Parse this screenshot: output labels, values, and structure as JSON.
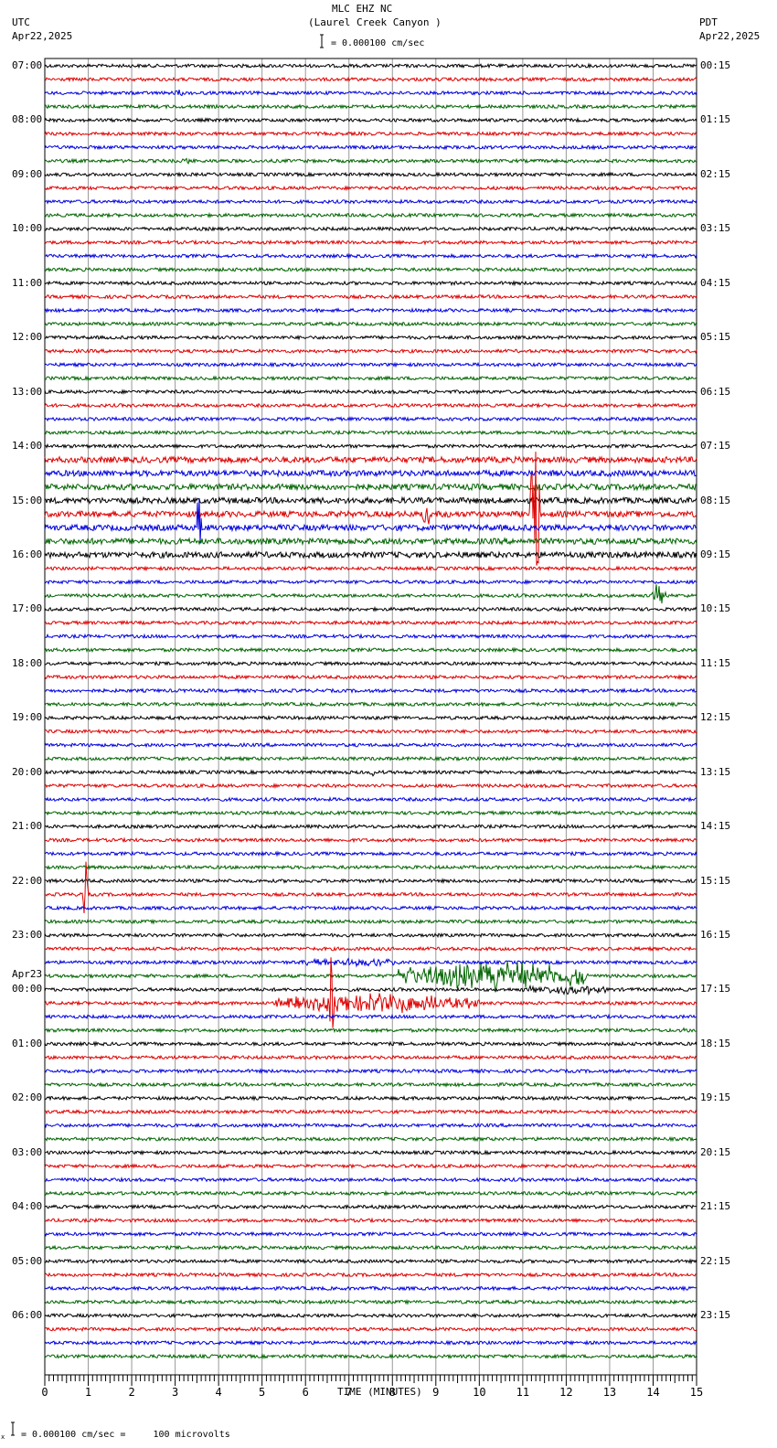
{
  "header": {
    "title": "MLC EHZ NC",
    "subtitle": "(Laurel Creek Canyon )",
    "scale": "= 0.000100 cm/sec",
    "left_tz": "UTC",
    "left_date": "Apr22,2025",
    "right_tz": "PDT",
    "right_date": "Apr22,2025"
  },
  "footer": {
    "scale_note": "= 0.000100 cm/sec =     100 microvolts",
    "footer_mark": "x"
  },
  "chart_data": {
    "type": "line",
    "title": "MLC EHZ NC (Laurel Creek Canyon )",
    "xlabel": "TIME (MINUTES)",
    "xlim": [
      0,
      15
    ],
    "xticks": [
      "0",
      "1",
      "2",
      "3",
      "4",
      "5",
      "6",
      "7",
      "8",
      "9",
      "10",
      "11",
      "12",
      "13",
      "14",
      "15"
    ],
    "trace_count": 96,
    "trace_colors": [
      "#000000",
      "#dd0000",
      "#0000dd",
      "#006400"
    ],
    "left_labels": [
      "07:00",
      "08:00",
      "09:00",
      "10:00",
      "11:00",
      "12:00",
      "13:00",
      "14:00",
      "15:00",
      "16:00",
      "17:00",
      "18:00",
      "19:00",
      "20:00",
      "21:00",
      "22:00",
      "23:00",
      "00:00",
      "01:00",
      "02:00",
      "03:00",
      "04:00",
      "05:00",
      "06:00"
    ],
    "left_date_change": "Apr23",
    "right_labels": [
      "00:15",
      "01:15",
      "02:15",
      "03:15",
      "04:15",
      "05:15",
      "06:15",
      "07:15",
      "08:15",
      "09:15",
      "10:15",
      "11:15",
      "12:15",
      "13:15",
      "14:15",
      "15:15",
      "16:15",
      "17:15",
      "18:15",
      "19:15",
      "20:15",
      "21:15",
      "22:15",
      "23:15"
    ],
    "noisy_traces": {
      "from": 29,
      "to": 36
    },
    "events": [
      {
        "trace": 2,
        "start": 3.0,
        "end": 3.2,
        "amp": 6
      },
      {
        "trace": 7,
        "start": 3.1,
        "end": 3.4,
        "amp": 4
      },
      {
        "trace": 33,
        "start": 11.15,
        "end": 11.4,
        "amp": 140
      },
      {
        "trace": 33,
        "start": 8.7,
        "end": 8.85,
        "amp": 22
      },
      {
        "trace": 33,
        "start": 9.2,
        "end": 9.3,
        "amp": 14
      },
      {
        "trace": 34,
        "start": 3.5,
        "end": 3.6,
        "amp": 55
      },
      {
        "trace": 39,
        "start": 13.95,
        "end": 14.3,
        "amp": 15
      },
      {
        "trace": 52,
        "start": 7.4,
        "end": 7.7,
        "amp": 5
      },
      {
        "trace": 61,
        "start": 0.85,
        "end": 1.0,
        "amp": 50
      },
      {
        "trace": 66,
        "start": 5.8,
        "end": 8.2,
        "amp": 6
      },
      {
        "trace": 67,
        "start": 8.1,
        "end": 12.5,
        "amp": 20
      },
      {
        "trace": 68,
        "start": 11.0,
        "end": 13.0,
        "amp": 7
      },
      {
        "trace": 69,
        "start": 5.3,
        "end": 10.0,
        "amp": 13
      },
      {
        "trace": 69,
        "start": 6.55,
        "end": 6.65,
        "amp": 80
      },
      {
        "trace": 71,
        "start": 14.6,
        "end": 14.9,
        "amp": 6
      }
    ]
  }
}
